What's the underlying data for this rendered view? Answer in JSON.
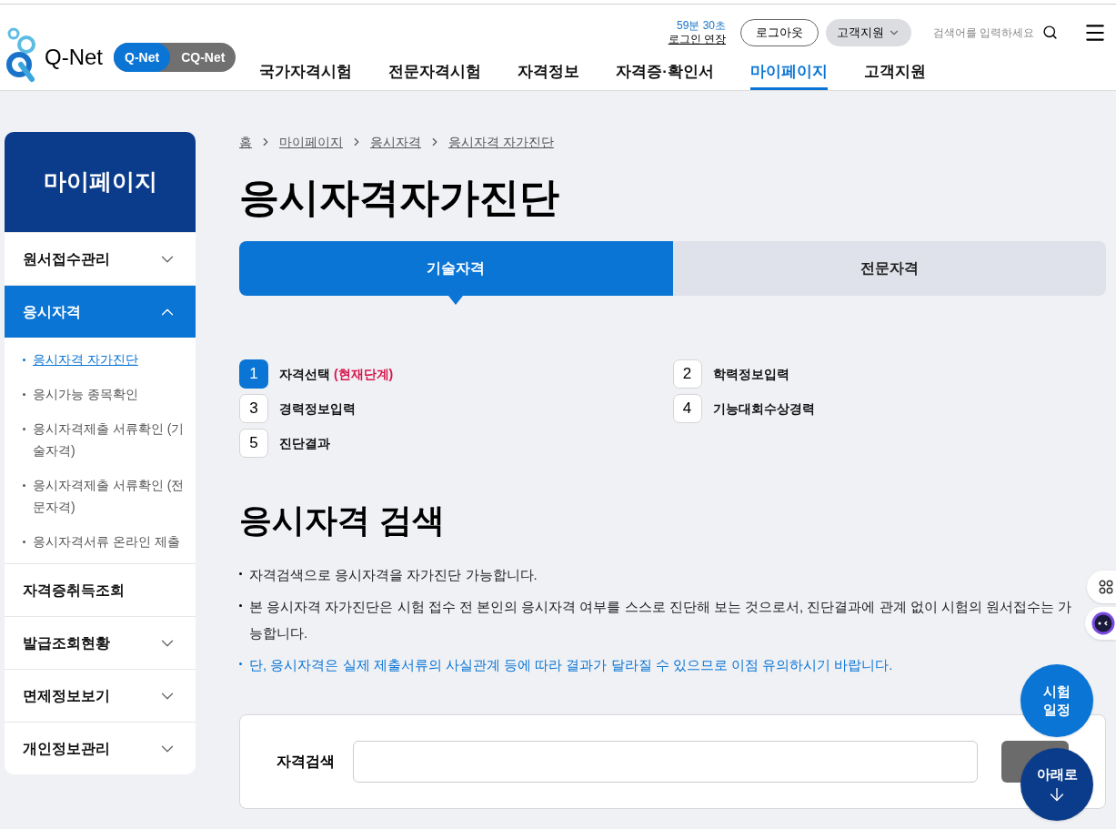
{
  "header": {
    "logo_text": "Q-Net",
    "site_toggle": [
      {
        "label": "Q-Net",
        "selected": true
      },
      {
        "label": "CQ-Net",
        "selected": false
      }
    ],
    "session": {
      "time": "59분 30초",
      "extend": "로그인 연장"
    },
    "logout": "로그아웃",
    "support_menu": "고객지원",
    "search": {
      "placeholder": "검색어를 입력하세요"
    },
    "nav": [
      {
        "label": "국가자격시험",
        "selected": false
      },
      {
        "label": "전문자격시험",
        "selected": false
      },
      {
        "label": "자격정보",
        "selected": false
      },
      {
        "label": "자격증·확인서",
        "selected": false
      },
      {
        "label": "마이페이지",
        "selected": true
      },
      {
        "label": "고객지원",
        "selected": false
      }
    ]
  },
  "sidebar": {
    "title": "마이페이지",
    "items": [
      {
        "label": "원서접수관리",
        "kind": "expandable",
        "expanded": false,
        "selected": false
      },
      {
        "label": "응시자격",
        "kind": "expandable",
        "expanded": true,
        "selected": true,
        "children": [
          {
            "label": "응시자격 자가진단",
            "selected": true
          },
          {
            "label": "응시가능 종목확인",
            "selected": false
          },
          {
            "label": "응시자격제출 서류확인 (기술자격)",
            "selected": false
          },
          {
            "label": "응시자격제출 서류확인 (전문자격)",
            "selected": false
          },
          {
            "label": "응시자격서류 온라인 제출",
            "selected": false
          }
        ]
      },
      {
        "label": "자격증취득조회",
        "kind": "link",
        "expanded": false,
        "selected": false
      },
      {
        "label": "발급조회현황",
        "kind": "expandable",
        "expanded": false,
        "selected": false
      },
      {
        "label": "면제정보보기",
        "kind": "expandable",
        "expanded": false,
        "selected": false
      },
      {
        "label": "개인정보관리",
        "kind": "expandable",
        "expanded": false,
        "selected": false
      }
    ]
  },
  "breadcrumb": [
    "홈",
    "마이페이지",
    "응시자격",
    "응시자격 자가진단"
  ],
  "page_title": "응시자격자가진단",
  "tabs": [
    {
      "label": "기술자격",
      "selected": true
    },
    {
      "label": "전문자격",
      "selected": false
    }
  ],
  "steps": [
    {
      "number": "1",
      "label": "자격선택",
      "note": "(현재단계)",
      "selected": true
    },
    {
      "number": "2",
      "label": "학력정보입력",
      "selected": false
    },
    {
      "number": "3",
      "label": "경력정보입력",
      "selected": false
    },
    {
      "number": "4",
      "label": "기능대회수상경력",
      "selected": false
    },
    {
      "number": "5",
      "label": "진단결과",
      "selected": false
    }
  ],
  "section_title": "응시자격 검색",
  "notes": [
    {
      "text": "자격검색으로 응시자격을 자가진단 가능합니다.",
      "highlight": false
    },
    {
      "text": "본 응시자격 자가진단은 시험 접수 전 본인의 응시자격 여부를 스스로 진단해 보는 것으로서, 진단결과에 관계 없이 시험의 원서접수는 가능합니다.",
      "highlight": false
    },
    {
      "text": "단, 응시자격은 실제 제출서류의 사실관계 등에 따라 결과가 달라질 수 있으므로 이점 유의하시기 바랍니다.",
      "highlight": true
    }
  ],
  "search_form": {
    "label": "자격검색"
  },
  "floating": {
    "schedule": [
      "시험",
      "일정"
    ],
    "down": "아래로"
  }
}
